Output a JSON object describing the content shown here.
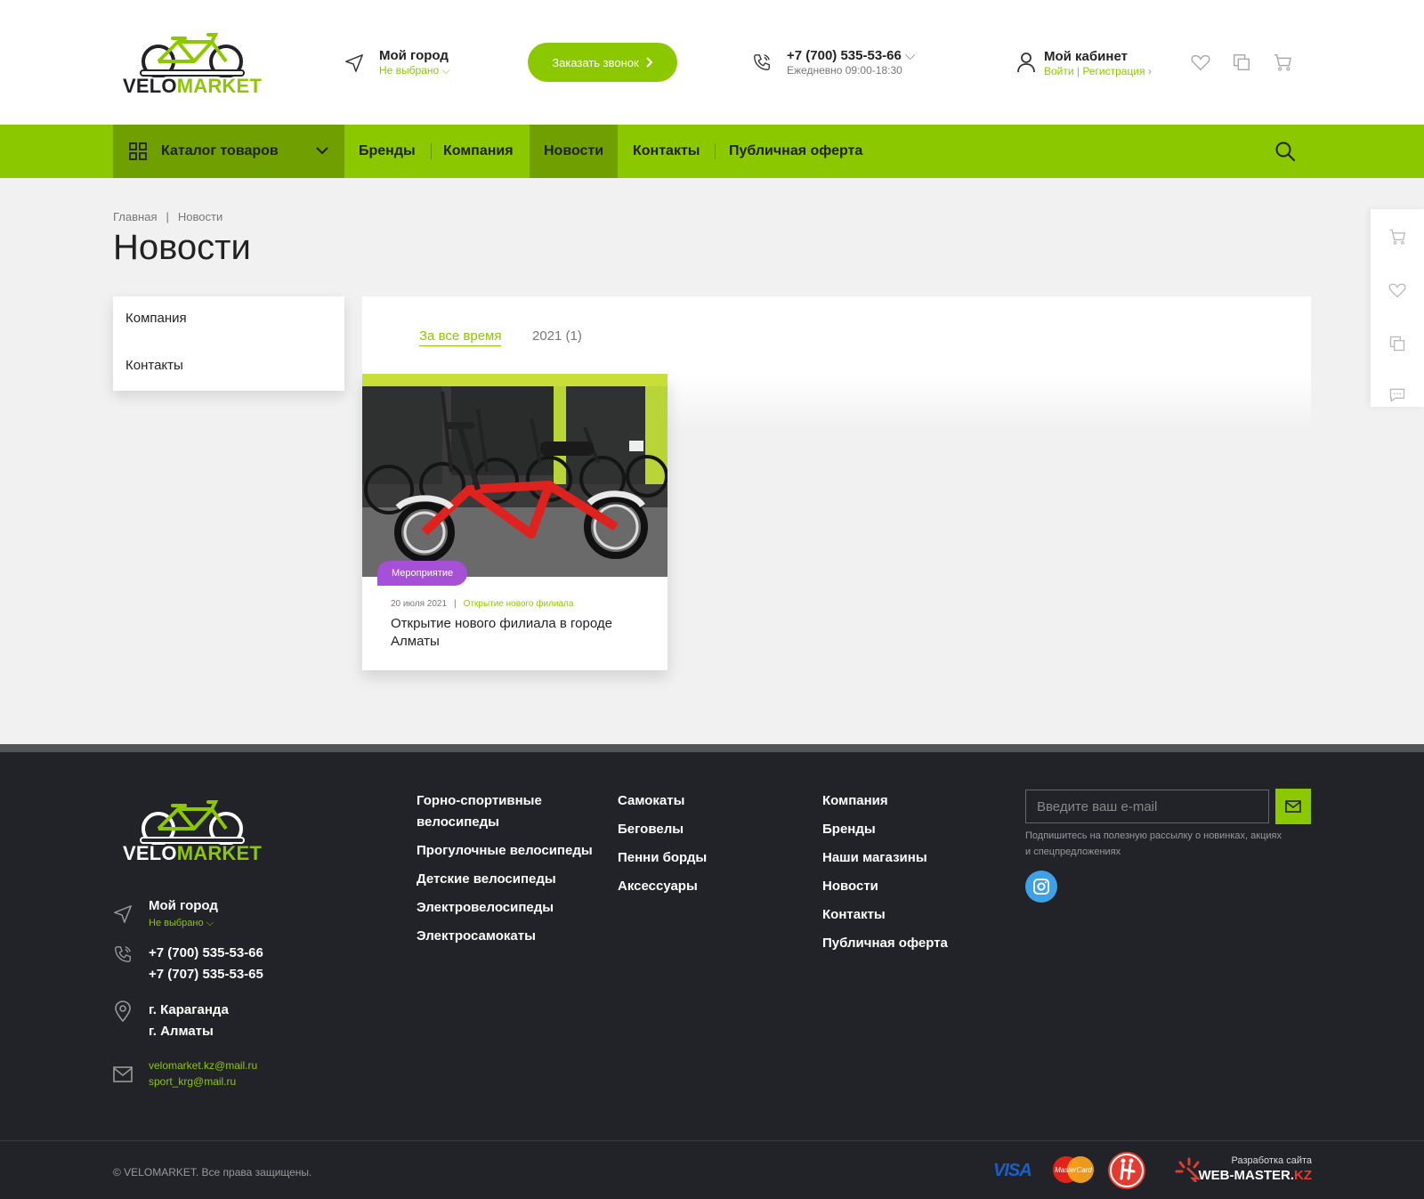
{
  "brand": {
    "logo_velo": "VELO",
    "logo_market": "MARKET"
  },
  "header": {
    "city_title": "Мой город",
    "city_value": "Не выбрано",
    "callback_label": "Заказать звонок",
    "phone": "+7 (700) 535-53-66",
    "phone_hours": "Ежедневно 09:00-18:30",
    "account_title": "Мой кабинет",
    "account_links": "Войти | Регистрация"
  },
  "nav": {
    "catalog_label": "Каталог товаров",
    "items": [
      "Бренды",
      "Компания",
      "Новости",
      "Контакты",
      "Публичная оферта"
    ],
    "active_index": 2
  },
  "breadcrumb": [
    "Главная",
    "|",
    "Новости"
  ],
  "page_title": "Новости",
  "side_menu": [
    "Компания",
    "Контакты"
  ],
  "filter_tabs": [
    "За все время",
    "2021 (1)"
  ],
  "news": [
    {
      "badge": "Мероприятие",
      "date": "20 июля 2021",
      "separator": "|",
      "category": "Открытие нового филиала",
      "title": "Открытие нового филиала в городе Алматы"
    }
  ],
  "footer": {
    "city_title": "Мой город",
    "city_value": "Не выбрано",
    "phones": [
      "+7 (700) 535-53-66",
      "+7 (707) 535-53-65"
    ],
    "addresses": [
      "г. Караганда",
      "г. Алматы"
    ],
    "emails": [
      "velomarket.kz@mail.ru",
      "sport_krg@mail.ru"
    ],
    "col1": [
      "Горно-спортивные велосипеды",
      "Прогулочные велосипеды",
      "Детские велосипеды",
      "Электровелосипеды",
      "Электросамокаты"
    ],
    "col2": [
      "Самокаты",
      "Беговелы",
      "Пенни борды",
      "Аксессуары"
    ],
    "col3": [
      "Компания",
      "Бренды",
      "Наши магазины",
      "Новости",
      "Контакты",
      "Публичная оферта"
    ],
    "email_placeholder": "Введите ваш e-mail",
    "subscribe_note": "Подпишитесь на полезную рассылку о новинках, акциях и спецпредложениях",
    "copyright": "© VELOMARKET. Все права защищены.",
    "payment_visa": "VISA",
    "payment_mc": "MasterCard",
    "dev_label": "Разработка сайта",
    "dev_name": "WEB-MASTER.",
    "dev_tld": "KZ"
  },
  "colors": {
    "accent": "#8cc800",
    "accent_dark": "#6f9f00",
    "badge": "#a64fd7",
    "footer_bg": "#222328"
  }
}
